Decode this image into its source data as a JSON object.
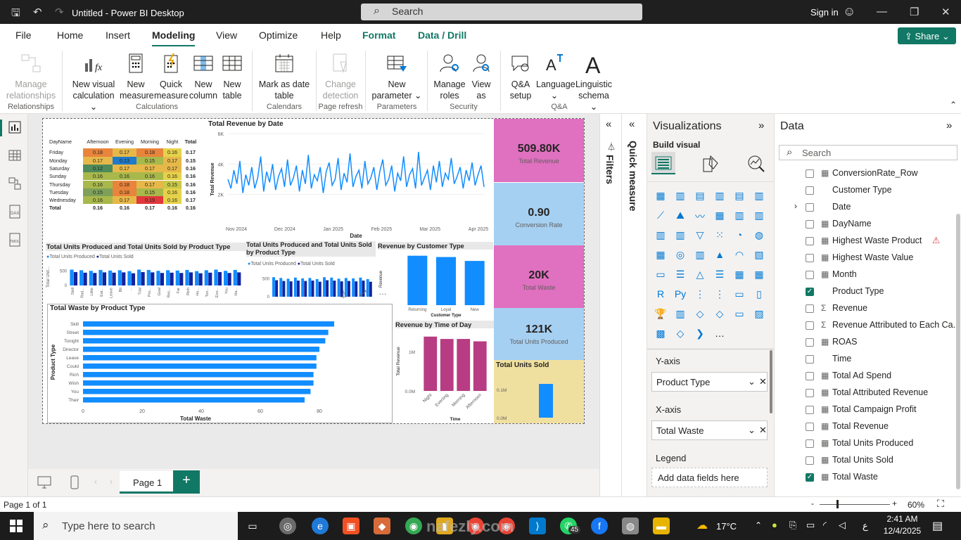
{
  "window": {
    "title": "Untitled - Power BI Desktop",
    "search_label": "Search",
    "signin": "Sign in"
  },
  "menu": {
    "tabs": [
      "File",
      "Home",
      "Insert",
      "Modeling",
      "View",
      "Optimize",
      "Help",
      "Format",
      "Data / Drill"
    ],
    "active": "Modeling",
    "share": "Share"
  },
  "ribbon": {
    "buttons": [
      "Manage relationships",
      "New visual calculation",
      "New measure",
      "Quick measure",
      "New column",
      "New table",
      "Mark as date table",
      "Change detection",
      "New parameter",
      "Manage roles",
      "View as",
      "Q&A setup",
      "Language",
      "Linguistic schema"
    ],
    "groups": [
      "Relationships",
      "Calculations",
      "Calendars",
      "Page refresh",
      "Parameters",
      "Security",
      "Q&A"
    ]
  },
  "matrix": {
    "headers": [
      "DayName",
      "Afternoon",
      "Evening",
      "Morning",
      "Night",
      "Total"
    ],
    "rows": [
      [
        "Friday",
        "0.18",
        "0.17",
        "0.18",
        "0.16",
        "0.17"
      ],
      [
        "Monday",
        "0.17",
        "0.13",
        "0.15",
        "0.17",
        "0.15"
      ],
      [
        "Saturday",
        "0.12",
        "0.17",
        "0.17",
        "0.17",
        "0.16"
      ],
      [
        "Sunday",
        "0.16",
        "0.16",
        "0.16",
        "0.16",
        "0.16"
      ],
      [
        "Thursday",
        "0.16",
        "0.18",
        "0.17",
        "0.15",
        "0.16"
      ],
      [
        "Tuesday",
        "0.15",
        "0.18",
        "0.15",
        "0.16",
        "0.16"
      ],
      [
        "Wednesday",
        "0.16",
        "0.17",
        "0.19",
        "0.16",
        "0.17"
      ],
      [
        "Total",
        "0.16",
        "0.16",
        "0.17",
        "0.16",
        "0.16"
      ]
    ],
    "colors": {
      "Friday": [
        "#e8843c",
        "#e6b84a",
        "#e8843c",
        "#e6d24a"
      ],
      "Monday": [
        "#e6b84a",
        "#1f7ac9",
        "#a8b84a",
        "#e6b84a"
      ],
      "Saturday": [
        "#4e8a5a",
        "#e6b84a",
        "#e6b84a",
        "#e6b84a"
      ],
      "Sunday": [
        "#a8b84a",
        "#a8b84a",
        "#a8b84a",
        "#e6d24a"
      ],
      "Thursday": [
        "#a8b84a",
        "#e8843c",
        "#e6b84a",
        "#c8c84a"
      ],
      "Tuesday": [
        "#7ea05a",
        "#e8843c",
        "#a8b84a",
        "#e6d24a"
      ],
      "Wednesday": [
        "#a8b84a",
        "#e6b84a",
        "#e0383c",
        "#e6d24a"
      ]
    }
  },
  "line_chart": {
    "title": "Total Revenue by Date",
    "xlabel": "Date",
    "ylabel": "Total Revenue",
    "yticks": [
      "6K",
      "4K",
      "2K"
    ],
    "xticks": [
      "Nov 2024",
      "Dec 2024",
      "Jan 2025",
      "Feb 2025",
      "Mar 2025",
      "Apr 2025"
    ]
  },
  "chart_data": [
    {
      "type": "line",
      "title": "Total Revenue by Date",
      "xlabel": "Date",
      "ylabel": "Total Revenue",
      "ylim": [
        0,
        6000
      ],
      "x_range": [
        "2024-11-01",
        "2025-04-30"
      ],
      "values": [
        3000,
        2400,
        3600,
        2700,
        4200,
        2100,
        3300,
        2600,
        3800,
        2400,
        3100,
        4500,
        2200,
        3500,
        2800,
        4000,
        2300,
        3200,
        3700,
        2500,
        4300,
        2600,
        3100,
        3900,
        2200,
        3600,
        2700,
        4600,
        2400,
        3300,
        2900,
        3800,
        2100,
        3500,
        4100,
        2600,
        3000,
        4400,
        2300,
        3400,
        2800,
        4700,
        2500,
        3200,
        3600,
        2400,
        4200,
        2700,
        3100,
        3800,
        2300,
        3500,
        4300,
        2600,
        3000,
        3900,
        2200,
        3400,
        2900,
        4500,
        2500,
        3300,
        3700,
        2400,
        4800,
        2600,
        3100,
        3600,
        2300,
        3900,
        2800,
        4200,
        2500,
        3400,
        3000,
        4400,
        2700,
        3200,
        3800,
        2400,
        3600,
        2900,
        4100,
        2600,
        3300,
        3900,
        2500
      ]
    },
    {
      "type": "bar",
      "title": "Total Units Produced and Total Units Sold by Product Type",
      "series": [
        {
          "name": "Total Units Produced",
          "values": [
            520,
            500,
            480,
            510,
            490,
            500,
            470,
            520,
            510,
            480,
            500,
            490,
            510,
            470,
            500,
            520,
            480,
            510
          ]
        },
        {
          "name": "Total Units Sold",
          "values": [
            440,
            420,
            410,
            430,
            420,
            430,
            400,
            440,
            430,
            410,
            420,
            410,
            430,
            400,
            420,
            440,
            410,
            430
          ]
        }
      ],
      "categories": [
        "Skill",
        "Rad...",
        "Little",
        "Eat...",
        "Leave",
        "Bit",
        "...",
        "Trial",
        "Pro...",
        "Goal",
        "Rec...",
        "Far",
        "Rich",
        "He...",
        "Ton...",
        "Eco...",
        "You",
        "Ha..."
      ],
      "yticks": [
        "500",
        "0"
      ]
    },
    {
      "type": "bar",
      "title": "Total Units Produced and Total Units Sold by Product Type",
      "series": [
        {
          "name": "Total Units Produced",
          "values": [
            520,
            500,
            480,
            510,
            490,
            500,
            470,
            520,
            510,
            480,
            500,
            490,
            510,
            470
          ]
        },
        {
          "name": "Total Units Sold",
          "values": [
            440,
            420,
            410,
            430,
            420,
            430,
            400,
            440,
            430,
            410,
            420,
            410,
            430,
            400
          ]
        }
      ],
      "yticks": [
        "500",
        "0"
      ]
    },
    {
      "type": "bar",
      "title": "Revenue by Customer Type",
      "categories": [
        "Returning",
        "Loyal",
        "New"
      ],
      "values": [
        0.38,
        0.37,
        0.34
      ],
      "xlabel": "Customer Type",
      "ylabel": "Revenue"
    },
    {
      "type": "bar",
      "title": "Total Waste by Product Type",
      "categories": [
        "Skill",
        "Street",
        "Tonight",
        "Director",
        "Leave",
        "Could",
        "Rich",
        "Wish",
        "You",
        "Their"
      ],
      "values": [
        85,
        83,
        82,
        80,
        79,
        79,
        78,
        78,
        77,
        75
      ],
      "xlabel": "Total Waste",
      "ylabel": "Product Type",
      "xticks": [
        "0",
        "20",
        "40",
        "60",
        "80"
      ],
      "xlim": [
        0,
        100
      ]
    },
    {
      "type": "bar",
      "title": "Revenue by Time of Day",
      "categories": [
        "Night",
        "Evening",
        "Morning",
        "Afternoon"
      ],
      "values": [
        1.38,
        1.32,
        1.32,
        1.26
      ],
      "ylabel": "Total Revenue",
      "xlabel": "Time",
      "yticks": [
        "1M",
        "0.0M"
      ]
    },
    {
      "type": "bar",
      "title": "Total Units Sold",
      "values": [
        0.12
      ],
      "yticks": [
        "0.1M",
        "0.0M"
      ]
    }
  ],
  "charts": {
    "units_title": "Total Units Produced and Total Units Sold by Product Type",
    "units_title2a": "Total Units Produced and Total Units Sold",
    "units_title2b": "by Product Type",
    "legend_produced": "Total Units Produced",
    "legend_sold": "Total Units Sold",
    "units_ylabel": "Total Unit...",
    "units_ytick_hi": "500",
    "units_ytick_lo": "0",
    "cust_title": "Revenue by Customer Type",
    "cust_xlabel": "Customer Type",
    "cust_ylabel": "Revenue",
    "waste_title": "Total Waste by Product Type",
    "waste_xlabel": "Total Waste",
    "waste_ylabel": "Product Type",
    "tod_title": "Revenue by Time of Day",
    "tod_xlabel": "Time",
    "tod_ylabel": "Total Revenue",
    "tod_ytick_hi": "1M",
    "tod_ytick_lo": "0.0M",
    "sold_title": "Total Units Sold",
    "sold_ytick_hi": "0.1M",
    "sold_ytick_lo": "0.0M"
  },
  "kpis": [
    {
      "value": "509.80K",
      "label": "Total Revenue",
      "color": "#e070c0"
    },
    {
      "value": "0.90",
      "label": "Conversion Rate",
      "color": "#a6d0f2"
    },
    {
      "value": "20K",
      "label": "Total Waste",
      "color": "#e070c0"
    },
    {
      "value": "121K",
      "label": "Total Units Produced",
      "color": "#a6d0f2"
    }
  ],
  "pane": {
    "filters": "Filters",
    "quick_measure": "Quick measure",
    "viz_title": "Visualizations",
    "build_visual": "Build visual",
    "y_axis": "Y-axis",
    "y_field": "Product Type",
    "x_axis": "X-axis",
    "x_field": "Total Waste",
    "legend": "Legend",
    "legend_placeholder": "Add data fields here"
  },
  "data_pane": {
    "title": "Data",
    "search": "Search",
    "items": [
      {
        "name": "ConversionRate_Row",
        "icon": "▦",
        "checked": false
      },
      {
        "name": "Customer Type",
        "icon": "",
        "checked": false
      },
      {
        "name": "Date",
        "icon": "",
        "checked": false,
        "expand": true
      },
      {
        "name": "DayName",
        "icon": "▦",
        "checked": false
      },
      {
        "name": "Highest Waste Product",
        "icon": "▦",
        "checked": false,
        "warn": true
      },
      {
        "name": "Highest Waste Value",
        "icon": "▦",
        "checked": false
      },
      {
        "name": "Month",
        "icon": "▦",
        "checked": false
      },
      {
        "name": "Product Type",
        "icon": "",
        "checked": true
      },
      {
        "name": "Revenue",
        "icon": "Σ",
        "checked": false
      },
      {
        "name": "Revenue Attributed to Each Ca...",
        "icon": "Σ",
        "checked": false
      },
      {
        "name": "ROAS",
        "icon": "▦",
        "checked": false
      },
      {
        "name": "Time",
        "icon": "",
        "checked": false
      },
      {
        "name": "Total Ad Spend",
        "icon": "▦",
        "checked": false
      },
      {
        "name": "Total Attributed Revenue",
        "icon": "▦",
        "checked": false
      },
      {
        "name": "Total Campaign Profit",
        "icon": "▦",
        "checked": false
      },
      {
        "name": "Total Revenue",
        "icon": "▦",
        "checked": false
      },
      {
        "name": "Total Units Produced",
        "icon": "▦",
        "checked": false
      },
      {
        "name": "Total Units Sold",
        "icon": "▦",
        "checked": false
      },
      {
        "name": "Total Waste",
        "icon": "▦",
        "checked": true
      }
    ]
  },
  "pagebar": {
    "page": "Page 1",
    "add": "+"
  },
  "status": {
    "page": "Page 1 of 1",
    "zoom": "60%"
  },
  "taskbar": {
    "search": "Type here to search",
    "weather": "17°C",
    "time": "2:41 AM",
    "date": "12/4/2025",
    "badge": "45",
    "lang": "ع"
  },
  "watermark": "nafezly.com"
}
